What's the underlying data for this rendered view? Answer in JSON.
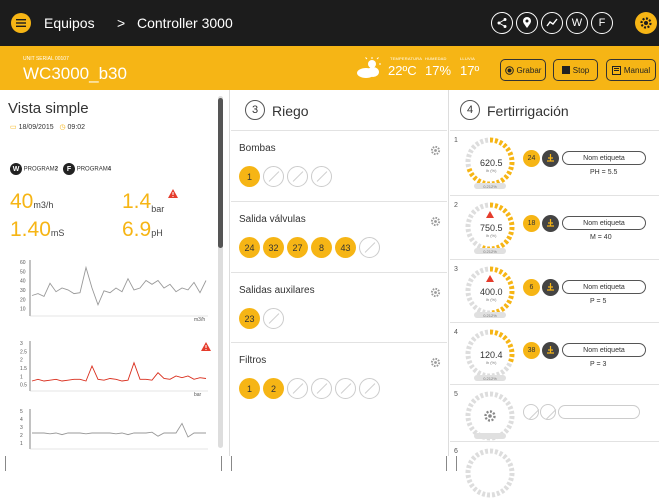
{
  "topbar": {
    "section": "Equipos",
    "separator": ">",
    "controller": "Controller 3000",
    "icons": [
      "share-icon",
      "location-icon",
      "trend-icon",
      "W",
      "F",
      "gear-icon"
    ]
  },
  "header": {
    "serial_label": "UNIT SERIAL 00107",
    "unit_name": "WC3000_b30",
    "weather": {
      "temp_label": "TEMPERATURA",
      "temp": "22ºC",
      "hum_label": "HUMEDAD",
      "hum": "17%",
      "rain_label": "LLUVIA",
      "rain": "17º"
    },
    "buttons": {
      "record": "Grabar",
      "stop": "Stop",
      "manual": "Manual"
    }
  },
  "left": {
    "title": "Vista simple",
    "date": "18/09/2015",
    "time": "09:02",
    "programs": {
      "w_badge": "W",
      "w_label": "PROGRAM",
      "w_num": "2",
      "f_badge": "F",
      "f_label": "PROGRAM",
      "f_num": "4"
    },
    "kpis": [
      {
        "value": "40",
        "unit": "m3/h"
      },
      {
        "value": "1.4",
        "unit": "bar"
      },
      {
        "value": "1.40",
        "unit": "mS"
      },
      {
        "value": "6.9",
        "unit": "pH"
      }
    ],
    "charts": [
      {
        "unit": "m3/h",
        "yticks": [
          "60",
          "50",
          "40",
          "30",
          "20",
          "10"
        ],
        "values": [
          22,
          24,
          21,
          35,
          26,
          30,
          28,
          24,
          25,
          52,
          30,
          12,
          27,
          25,
          30,
          26,
          40,
          28,
          30,
          38,
          34,
          38,
          30,
          34,
          26,
          30,
          28,
          36,
          25,
          38
        ]
      },
      {
        "unit": "bar",
        "yticks": [
          "3",
          "2.5",
          "2",
          "1.5",
          "1",
          "0.5"
        ],
        "values": [
          0.6,
          0.7,
          0.6,
          0.65,
          0.7,
          0.6,
          0.65,
          0.7,
          0.7,
          0.6,
          1.5,
          0.7,
          0.65,
          0.75,
          0.7,
          0.6,
          0.65,
          1.7,
          0.7,
          0.7,
          0.65,
          1.1,
          0.75,
          0.7,
          0.9,
          0.8,
          0.9,
          0.7,
          0.8,
          0.75
        ]
      },
      {
        "unit": "",
        "yticks": [
          "5",
          "4",
          "3",
          "2",
          "1"
        ],
        "values": [
          2,
          2,
          2,
          1.9,
          2,
          1.8,
          2,
          2,
          2,
          1.9,
          2,
          2,
          2,
          2,
          1.9,
          2,
          1.8,
          2,
          2,
          2,
          2.1,
          1.6,
          2,
          2,
          2,
          3.2,
          1.5,
          2,
          2,
          2
        ]
      }
    ]
  },
  "riego": {
    "num": "3",
    "title": "Riego",
    "groups": [
      {
        "label": "Bombas",
        "active": [
          "1"
        ],
        "inactive": 3
      },
      {
        "label": "Salida válvulas",
        "active": [
          "24",
          "32",
          "27",
          "8",
          "43"
        ],
        "inactive": 1
      },
      {
        "label": "Salidas auxilares",
        "active": [
          "23"
        ],
        "inactive": 1
      },
      {
        "label": "Filtros",
        "active": [
          "1",
          "2"
        ],
        "inactive": 4
      }
    ]
  },
  "fert": {
    "num": "4",
    "title": "Fertirrigación",
    "rows": [
      {
        "num": "1",
        "value": "620.5",
        "unit": "lh (%)",
        "sub": "0.212%",
        "count": "24",
        "label": "Nom etiqueta",
        "info": "PH = 5.5",
        "alert": false,
        "level": 0.7,
        "enabled": true
      },
      {
        "num": "2",
        "value": "750.5",
        "unit": "lh (%)",
        "sub": "0.212%",
        "count": "18",
        "label": "Nom etiqueta",
        "info": "M = 40",
        "alert": true,
        "level": 0.55,
        "enabled": true
      },
      {
        "num": "3",
        "value": "400.0",
        "unit": "lh (%)",
        "sub": "0.212%",
        "count": "6",
        "label": "Nom etiqueta",
        "info": "P = 5",
        "alert": true,
        "level": 0.5,
        "enabled": true
      },
      {
        "num": "4",
        "value": "120.4",
        "unit": "lh (%)",
        "sub": "0.212%",
        "count": "38",
        "label": "Nom etiqueta",
        "info": "P = 3",
        "alert": false,
        "level": 0.3,
        "enabled": true
      },
      {
        "num": "5",
        "value": "",
        "unit": "",
        "sub": "",
        "count": "",
        "label": "",
        "info": "",
        "alert": false,
        "level": 0,
        "enabled": false
      },
      {
        "num": "6",
        "value": "",
        "unit": "",
        "sub": "",
        "count": "",
        "label": "",
        "info": "",
        "alert": false,
        "level": 0,
        "enabled": false
      }
    ]
  },
  "colors": {
    "accent": "#f6b515",
    "dark": "#1c1c1c",
    "alert": "#e53c2c",
    "series_bar": "#d92d1c",
    "series_gray": "#999999"
  }
}
